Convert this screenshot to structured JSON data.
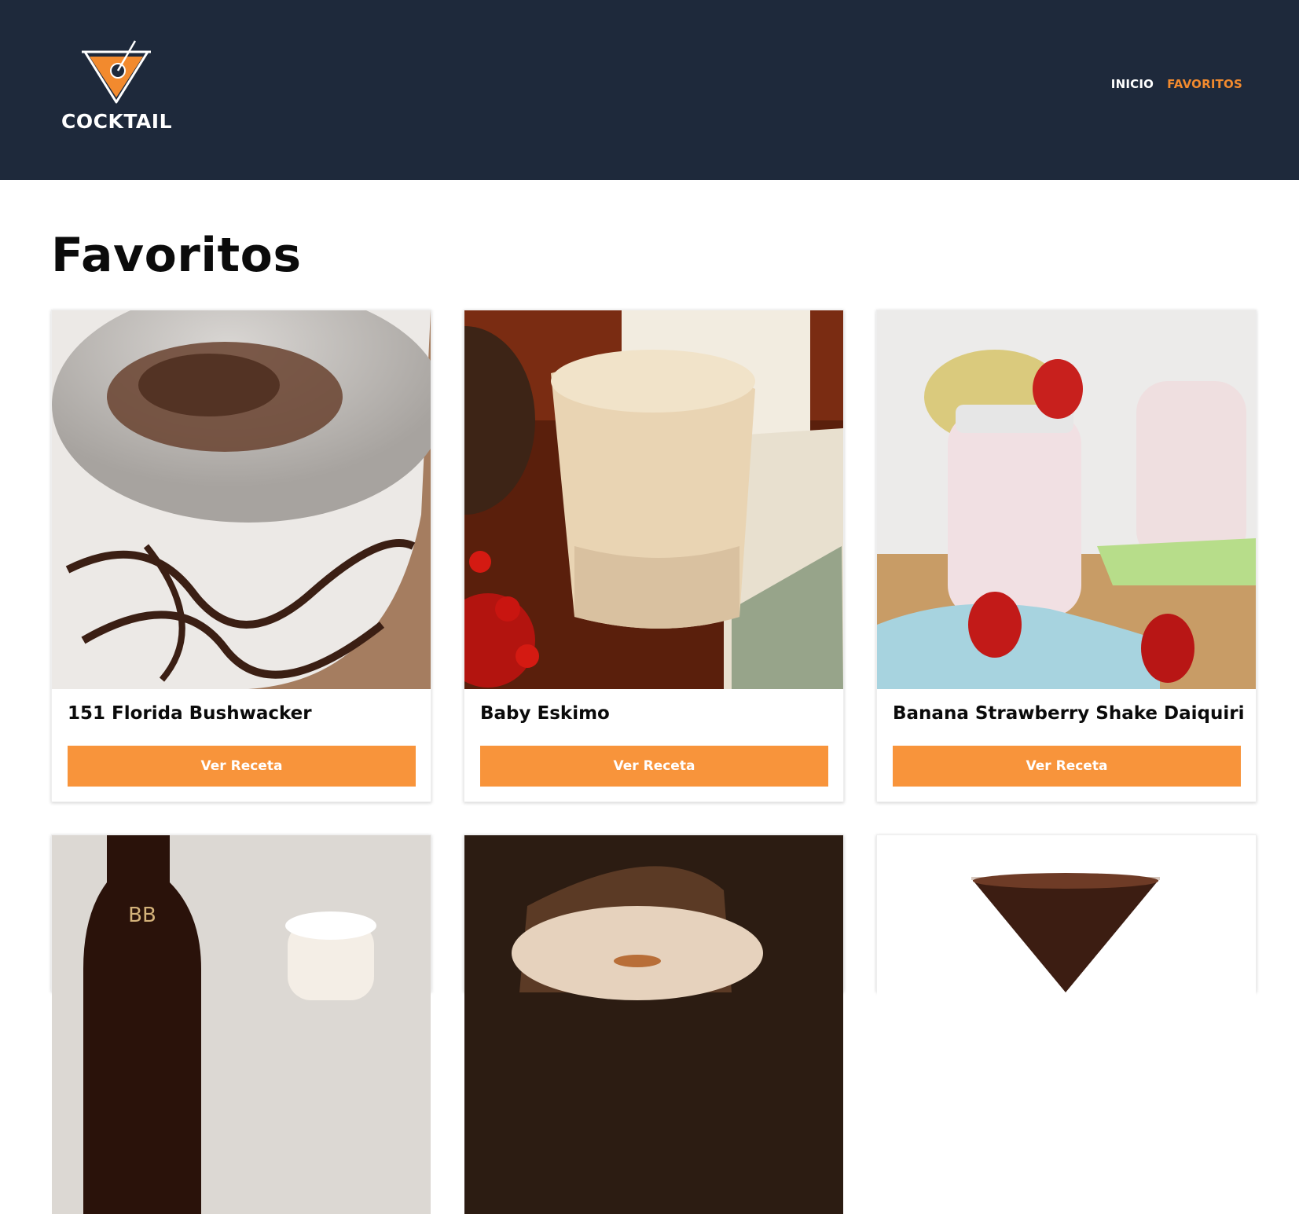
{
  "header": {
    "logo_text": "COCKTAIL",
    "background": "#1e293b",
    "nav": [
      {
        "label": "INICIO",
        "active": false
      },
      {
        "label": "FAVORITOS",
        "active": true
      }
    ],
    "accent": "#f28a2e"
  },
  "main": {
    "title": "Favoritos",
    "cards": [
      {
        "name": "151 Florida Bushwacker",
        "button": "Ver Receta",
        "image": "cocktail-photo"
      },
      {
        "name": "Baby Eskimo",
        "button": "Ver Receta",
        "image": "cocktail-photo"
      },
      {
        "name": "Banana Strawberry Shake Daiquiri",
        "button": "Ver Receta",
        "image": "cocktail-photo"
      },
      {
        "image": "cocktail-photo"
      },
      {
        "image": "cocktail-photo"
      },
      {
        "image": "cocktail-photo"
      }
    ],
    "button_color": "#f8943b"
  }
}
